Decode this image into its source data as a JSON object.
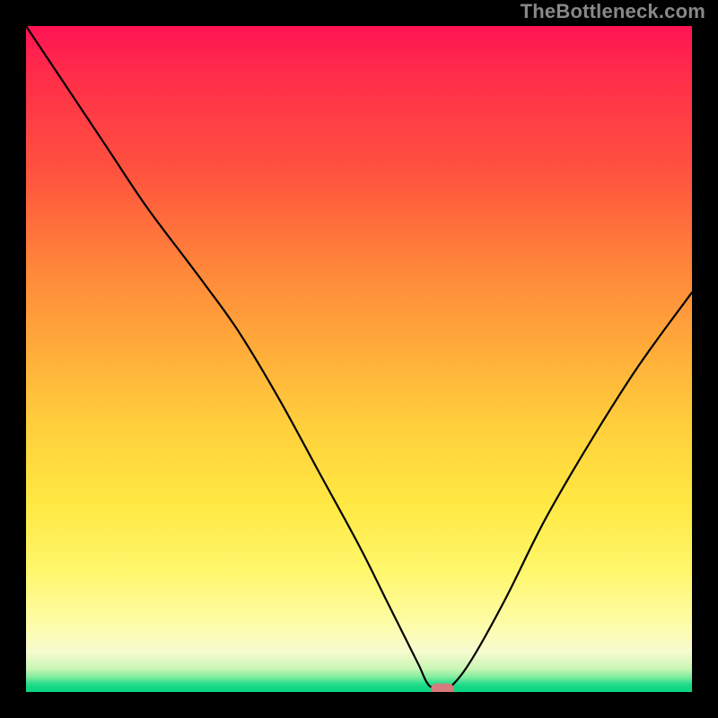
{
  "watermark": "TheBottleneck.com",
  "colors": {
    "frame_bg": "#000000",
    "watermark": "#888888",
    "curve": "#000000",
    "marker": "#d77b7d",
    "gradient_stops": [
      "#ff1453",
      "#ff2f49",
      "#ff533e",
      "#ff853a",
      "#ffaa3a",
      "#ffcf3c",
      "#ffe943",
      "#fff76d",
      "#fdfca9",
      "#f6fbd0",
      "#c9f6b5",
      "#7eec9e",
      "#34e08f",
      "#14d884",
      "#0bd481"
    ]
  },
  "chart_data": {
    "type": "line",
    "title": "",
    "xlabel": "",
    "ylabel": "",
    "xlim": [
      0,
      100
    ],
    "ylim": [
      0,
      100
    ],
    "grid": false,
    "series": [
      {
        "name": "bottleneck-curve",
        "x": [
          0,
          6,
          12,
          18,
          24,
          27,
          32,
          38,
          44,
          50,
          54,
          57,
          59,
          60.5,
          62.5,
          64,
          67,
          72,
          78,
          85,
          92,
          100
        ],
        "y": [
          100,
          91,
          82,
          73,
          65,
          61,
          54,
          44,
          33,
          22,
          14,
          8,
          4,
          1,
          0.4,
          1,
          5,
          14,
          26,
          38,
          49,
          60
        ]
      }
    ],
    "marker": {
      "x": 62.5,
      "y": 0.4
    },
    "notes": "x is horizontal position (0=left edge of plot, 100=right edge). y is vertical position (0=bottom of plot, 100=top). Values estimated from pixels; no axis ticks or labels are present in the original image."
  }
}
